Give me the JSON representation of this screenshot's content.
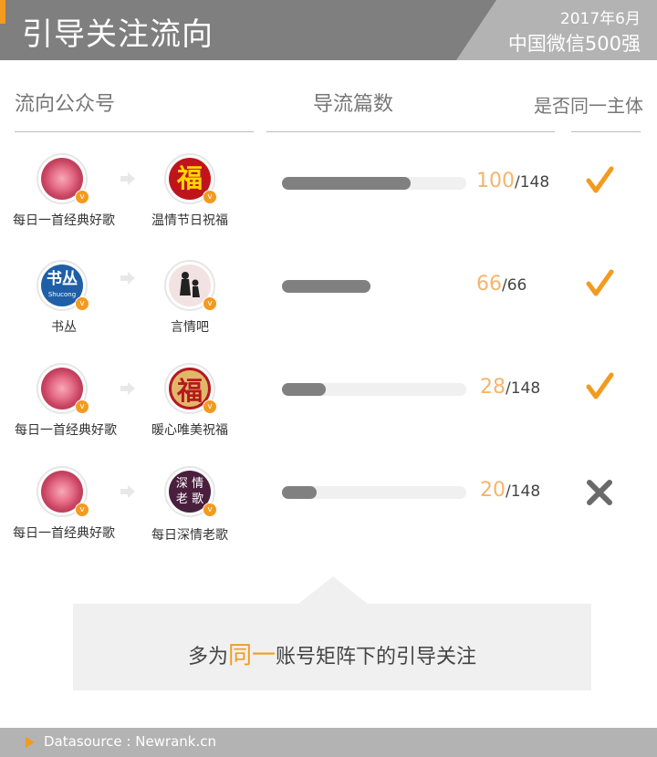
{
  "header": {
    "title": "引导关注流向",
    "date": "2017年6月",
    "rank": "中国微信500强"
  },
  "columns": {
    "flow": "流向公众号",
    "count": "导流篇数",
    "same": "是否同一主体"
  },
  "rows": [
    {
      "from": "每日一首经典好歌",
      "to": "温情节日祝福",
      "num": "100",
      "total": "/148",
      "fraction": 0.7,
      "same": true
    },
    {
      "from": "书丛",
      "to": "言情吧",
      "num": "66",
      "total": "/66",
      "fraction": 0.48,
      "same": true
    },
    {
      "from": "每日一首经典好歌",
      "to": "暖心唯美祝福",
      "num": "28",
      "total": "/148",
      "fraction": 0.24,
      "same": true
    },
    {
      "from": "每日一首经典好歌",
      "to": "每日深情老歌",
      "num": "20",
      "total": "/148",
      "fraction": 0.19,
      "same": false
    }
  ],
  "avatars": {
    "fu": "福",
    "shucong_big": "书丛",
    "shucong_small": "Shucong",
    "shenqing": [
      "深",
      "情",
      "老",
      "歌"
    ],
    "badge": "v"
  },
  "callout": {
    "before": "多为",
    "highlight": "同一",
    "after": "账号矩阵下的引导关注"
  },
  "footer": {
    "source": "Datasource : Newrank.cn"
  },
  "colors": {
    "accent": "#f39a1f",
    "bar": "#808080",
    "number": "#f5b56b",
    "header_bg": "#7f7f7f"
  }
}
